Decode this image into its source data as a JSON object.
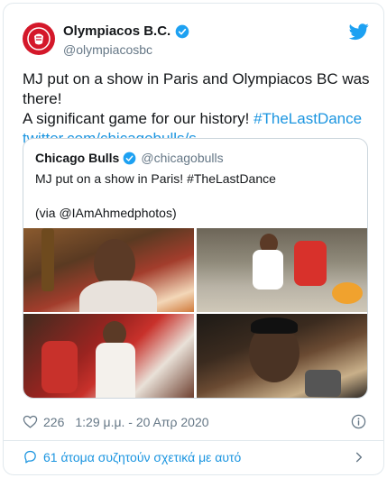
{
  "tweet": {
    "author": {
      "display_name": "Olympiacos B.C.",
      "handle": "@olympiacosbc",
      "avatar_icon": "olympiacos-logo-icon",
      "verified": true
    },
    "text_line1": "MJ put on a show in Paris and Olympiacos BC was there!",
    "text_line2": "A significant game for our history! ",
    "hashtag": "#TheLastDance",
    "link": "twitter.com/chicagobulls/s…",
    "quoted": {
      "display_name": "Chicago Bulls",
      "handle": "@chicagobulls",
      "verified": true,
      "text": "MJ put on a show in Paris! #TheLastDance",
      "via": "(via @IAmAhmedphotos)",
      "photo_count": 4
    },
    "likes": "226",
    "timestamp": "1:29 μ.μ. - 20 Απρ 2020",
    "conversation": "61 άτομα συζητούν σχετικά με αυτό"
  },
  "colors": {
    "link": "#1b95e0",
    "meta": "#657786",
    "brand_red": "#d4182a"
  },
  "icons": [
    "twitter-bird-icon",
    "verified-badge-icon",
    "heart-icon",
    "info-icon",
    "speech-bubble-icon",
    "chevron-right-icon"
  ]
}
